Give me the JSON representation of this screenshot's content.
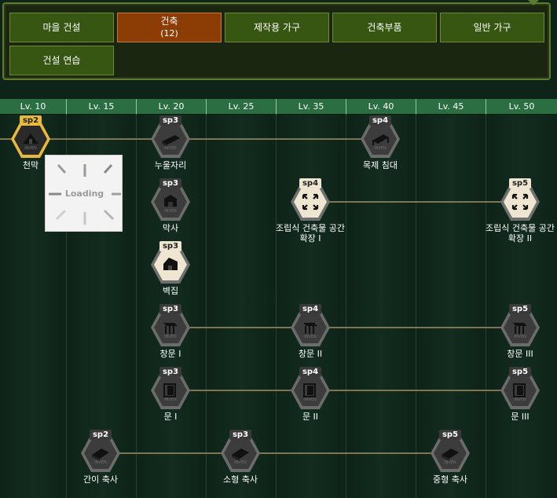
{
  "tabs": [
    {
      "label": "마을 건설",
      "sub": "",
      "active": false
    },
    {
      "label": "건축",
      "sub": "(12)",
      "active": true
    },
    {
      "label": "제작용 가구",
      "sub": "",
      "active": false
    },
    {
      "label": "건축부품",
      "sub": "",
      "active": false
    },
    {
      "label": "일반 가구",
      "sub": "",
      "active": false
    },
    {
      "label": "건설 연습",
      "sub": "",
      "active": false
    }
  ],
  "levels": [
    "Lv. 10",
    "Lv. 15",
    "Lv. 20",
    "Lv. 25",
    "Lv. 35",
    "Lv. 40",
    "Lv. 45",
    "Lv. 50"
  ],
  "loading": {
    "text": "Loading"
  },
  "nodes": [
    {
      "id": "tent",
      "sp": "sp2",
      "label": "천막",
      "state": "selected",
      "icon": "tent-icon"
    },
    {
      "id": "nuul",
      "sp": "sp3",
      "label": "누울자리",
      "state": "locked",
      "icon": "bedroll-icon"
    },
    {
      "id": "wood-bed",
      "sp": "sp4",
      "label": "목제 침대",
      "state": "locked",
      "icon": "bed-icon"
    },
    {
      "id": "maksa",
      "sp": "sp3",
      "label": "막사",
      "state": "locked",
      "icon": "barracks-icon"
    },
    {
      "id": "prefab-1",
      "sp": "sp4",
      "label": "조립식 건축물 공간\n확장 I",
      "state": "available",
      "icon": "expand-icon"
    },
    {
      "id": "prefab-2",
      "sp": "sp5",
      "label": "조립식 건축물 공간\n확장 II",
      "state": "available",
      "icon": "expand-icon"
    },
    {
      "id": "byeokjip",
      "sp": "sp3",
      "label": "벽집",
      "state": "available",
      "icon": "hut-icon"
    },
    {
      "id": "window-1",
      "sp": "sp3",
      "label": "창문 I",
      "state": "locked",
      "icon": "window-icon"
    },
    {
      "id": "window-2",
      "sp": "sp4",
      "label": "창문 II",
      "state": "locked",
      "icon": "window-icon"
    },
    {
      "id": "window-3",
      "sp": "sp5",
      "label": "창문 III",
      "state": "locked",
      "icon": "window-icon"
    },
    {
      "id": "door-1",
      "sp": "sp3",
      "label": "문 I",
      "state": "locked",
      "icon": "door-icon"
    },
    {
      "id": "door-2",
      "sp": "sp4",
      "label": "문 II",
      "state": "locked",
      "icon": "door-icon"
    },
    {
      "id": "door-3",
      "sp": "sp5",
      "label": "문 III",
      "state": "locked",
      "icon": "door-icon"
    },
    {
      "id": "shed-simple",
      "sp": "sp2",
      "label": "간이 축사",
      "state": "locked",
      "icon": "shed-icon"
    },
    {
      "id": "shed-small",
      "sp": "sp3",
      "label": "소형 축사",
      "state": "locked",
      "icon": "shed-icon"
    },
    {
      "id": "shed-medium",
      "sp": "sp5",
      "label": "중형 축사",
      "state": "locked",
      "icon": "shed-icon"
    }
  ],
  "colors": {
    "active_tab": "#8c3d06",
    "tab": "#365611",
    "header": "#2a6e42",
    "selected_node": "#e8b93a",
    "connector": "#7d7652"
  }
}
